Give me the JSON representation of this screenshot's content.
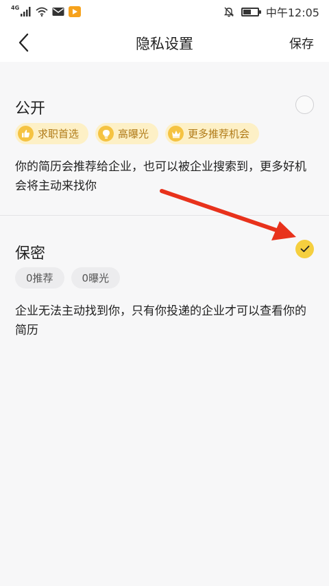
{
  "status_bar": {
    "network": "4G",
    "time": "中午12:05"
  },
  "nav": {
    "title": "隐私设置",
    "save_label": "保存"
  },
  "public": {
    "title": "公开",
    "selected": false,
    "tags": [
      {
        "icon": "thumbs-up-icon",
        "label": "求职首选"
      },
      {
        "icon": "lightbulb-icon",
        "label": "高曝光"
      },
      {
        "icon": "crown-icon",
        "label": "更多推荐机会"
      }
    ],
    "description": "你的简历会推荐给企业，也可以被企业搜索到，更多好机会将主动来找你"
  },
  "private": {
    "title": "保密",
    "selected": true,
    "tags": [
      {
        "label": "0推荐"
      },
      {
        "label": "0曝光"
      }
    ],
    "description": "企业无法主动找到你，只有你投递的企业才可以查看你的简历"
  },
  "colors": {
    "accent": "#f5cf3f",
    "tag_bg": "#fdf0c6",
    "tag_text": "#b07a17",
    "annotation_arrow": "#e8321c"
  }
}
